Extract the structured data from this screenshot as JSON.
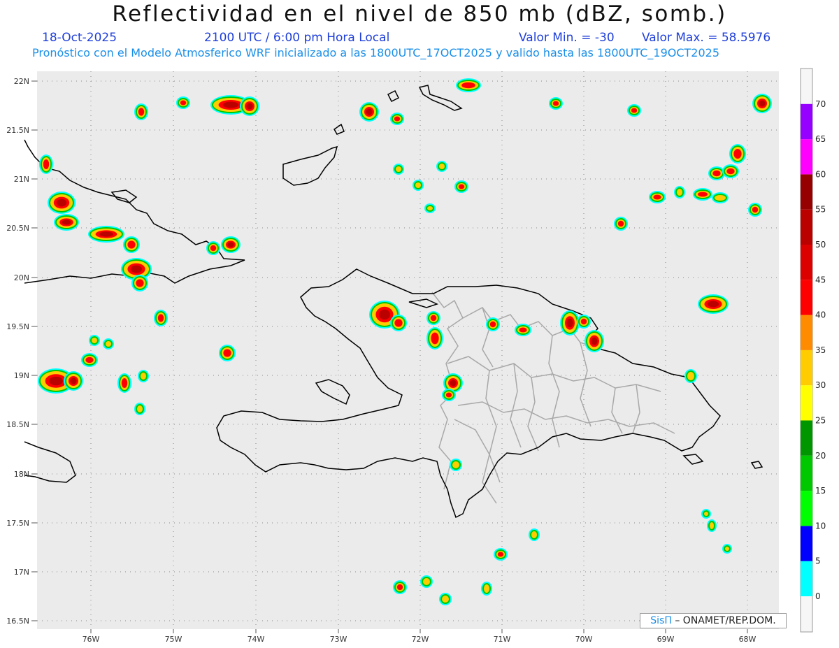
{
  "header": {
    "title": "Reflectividad en el nivel de 850 mb (dBZ, somb.)",
    "date": "18-Oct-2025",
    "time": "2100 UTC / 6:00 pm Hora Local",
    "min_value": "Valor Min. = -30",
    "max_value": "Valor Max. = 58.5976",
    "model_info": "Pronóstico con el Modelo Atmosferico WRF inicializado a las 1800UTC_17OCT2025 y valido hasta las  1800UTC_19OCT2025"
  },
  "map": {
    "lat_labels": [
      "22N",
      "21.5N",
      "21N",
      "20.5N",
      "20N",
      "19.5N",
      "19N",
      "18.5N",
      "18N",
      "17.5N",
      "17N",
      "16.5N"
    ],
    "lon_labels": [
      "76W",
      "75W",
      "74W",
      "73W",
      "72W",
      "71W",
      "70W",
      "69W",
      "68W"
    ],
    "colors": {
      "background": "#ebebeb",
      "coast": "#000000",
      "provinces": "#a8a8a8",
      "grid": "#8a8a8a"
    }
  },
  "colorbar": {
    "labels": [
      "0",
      "5",
      "10",
      "15",
      "20",
      "25",
      "30",
      "35",
      "40",
      "45",
      "50",
      "55",
      "60",
      "65",
      "70"
    ],
    "colors": [
      "#00ffff",
      "#0096ff",
      "#0000ff",
      "#00ff00",
      "#00c800",
      "#009600",
      "#ffff00",
      "#ffcc00",
      "#ff8c00",
      "#ff0000",
      "#dc0000",
      "#bb0000",
      "#960000",
      "#ff00ff",
      "#9600ff"
    ]
  },
  "credit": {
    "sis": "SisΠ",
    "org": " – ONAMET/REP.DOM."
  }
}
